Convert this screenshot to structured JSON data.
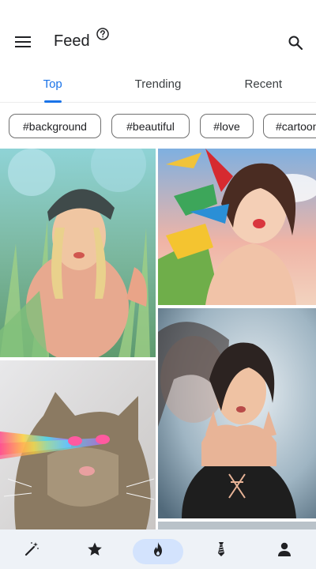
{
  "appbar": {
    "title": "Feed",
    "icons": {
      "menu": "menu-icon",
      "help": "help-icon",
      "search": "search-icon"
    }
  },
  "tabs": [
    {
      "label": "Top",
      "active": true
    },
    {
      "label": "Trending",
      "active": false
    },
    {
      "label": "Recent",
      "active": false
    }
  ],
  "chips": [
    "#background",
    "#beautiful",
    "#love",
    "#cartoon"
  ],
  "feed": {
    "images": [
      "woman-in-hat-among-grass-painting",
      "woman-with-parrots-cartoon",
      "cat-with-laser-eyes",
      "woman-double-exposure-cartoon"
    ]
  },
  "bottom_nav": {
    "items": [
      {
        "icon": "magic-wand-icon",
        "active": false
      },
      {
        "icon": "star-icon",
        "active": false
      },
      {
        "icon": "fire-icon",
        "active": true
      },
      {
        "icon": "tie-icon",
        "active": false
      },
      {
        "icon": "person-icon",
        "active": false
      }
    ]
  },
  "colors": {
    "accent": "#1a73e8",
    "nav_bg": "#eef2f7",
    "active_pill": "#d3e3fd"
  }
}
